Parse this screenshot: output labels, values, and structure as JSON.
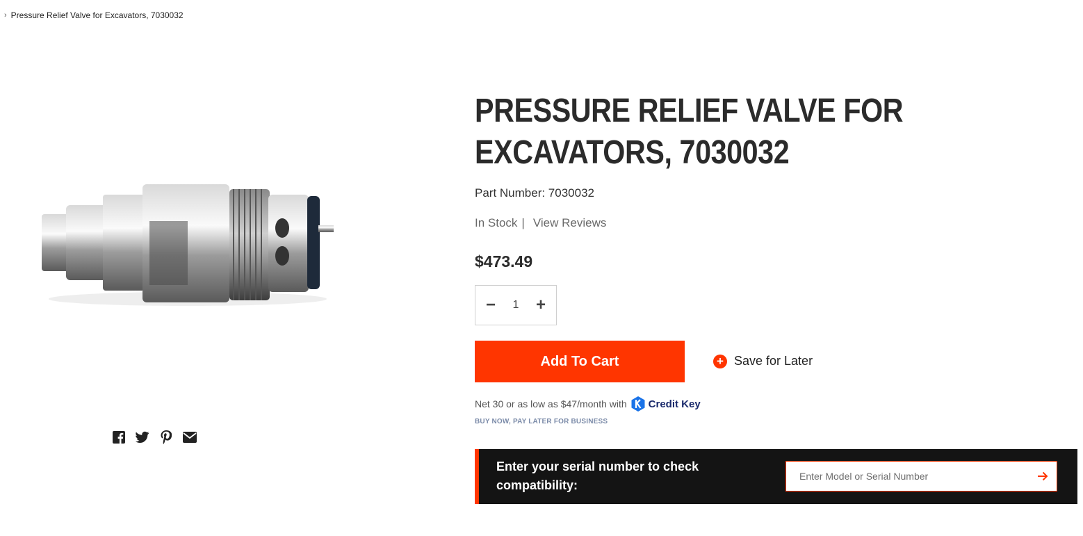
{
  "breadcrumb": {
    "current": "Pressure Relief Valve for Excavators, 7030032"
  },
  "product": {
    "title": "PRESSURE RELIEF VALVE FOR EXCAVATORS, 7030032",
    "part_number_label": "Part Number: 7030032",
    "stock_status": "In Stock",
    "separator": "|",
    "reviews_link": "View Reviews",
    "price": "$473.49",
    "quantity": "1"
  },
  "actions": {
    "add_to_cart": "Add To Cart",
    "save_for_later": "Save for Later"
  },
  "financing": {
    "text": "Net 30 or as low as $47/month with",
    "brand": "Credit Key",
    "tagline": "BUY NOW, PAY LATER FOR BUSINESS"
  },
  "serial_check": {
    "label": "Enter your serial number to check compatibility:",
    "placeholder": "Enter Model or Serial Number"
  },
  "share": [
    "facebook-icon",
    "twitter-icon",
    "pinterest-icon",
    "email-icon"
  ],
  "colors": {
    "accent": "#ff3500",
    "dark_bar": "#141414",
    "credit_key_blue": "#1a73e8"
  }
}
